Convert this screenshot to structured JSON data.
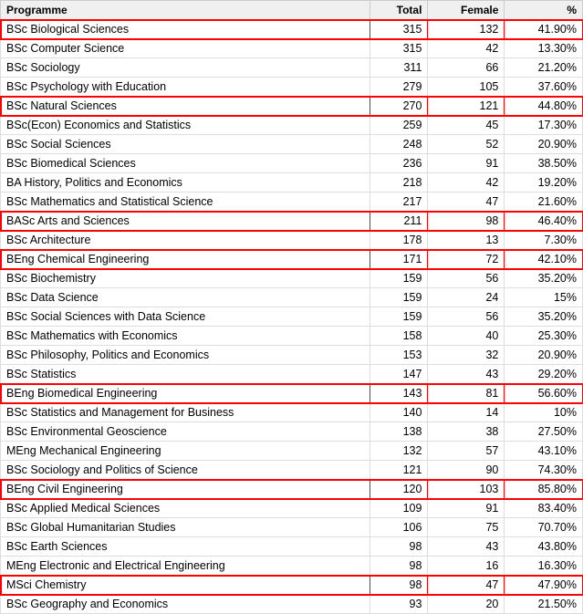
{
  "table": {
    "columns": [
      "Programme",
      "Total",
      "Female",
      "%"
    ],
    "rows": [
      {
        "name": "BSc Biological Sciences",
        "total": 315,
        "female": 132,
        "pct": "41.90%",
        "highlight": true
      },
      {
        "name": "BSc Computer Science",
        "total": 315,
        "female": 42,
        "pct": "13.30%",
        "highlight": false
      },
      {
        "name": "BSc Sociology",
        "total": 311,
        "female": 66,
        "pct": "21.20%",
        "highlight": false
      },
      {
        "name": "BSc Psychology with Education",
        "total": 279,
        "female": 105,
        "pct": "37.60%",
        "highlight": false
      },
      {
        "name": "BSc Natural Sciences",
        "total": 270,
        "female": 121,
        "pct": "44.80%",
        "highlight": true
      },
      {
        "name": "BSc(Econ) Economics and Statistics",
        "total": 259,
        "female": 45,
        "pct": "17.30%",
        "highlight": false
      },
      {
        "name": "BSc Social Sciences",
        "total": 248,
        "female": 52,
        "pct": "20.90%",
        "highlight": false
      },
      {
        "name": "BSc Biomedical Sciences",
        "total": 236,
        "female": 91,
        "pct": "38.50%",
        "highlight": false
      },
      {
        "name": "BA History, Politics and Economics",
        "total": 218,
        "female": 42,
        "pct": "19.20%",
        "highlight": false
      },
      {
        "name": "BSc Mathematics and Statistical Science",
        "total": 217,
        "female": 47,
        "pct": "21.60%",
        "highlight": false
      },
      {
        "name": "BASc Arts and Sciences",
        "total": 211,
        "female": 98,
        "pct": "46.40%",
        "highlight": true
      },
      {
        "name": "BSc Architecture",
        "total": 178,
        "female": 13,
        "pct": "7.30%",
        "highlight": false
      },
      {
        "name": "BEng Chemical Engineering",
        "total": 171,
        "female": 72,
        "pct": "42.10%",
        "highlight": true
      },
      {
        "name": "BSc Biochemistry",
        "total": 159,
        "female": 56,
        "pct": "35.20%",
        "highlight": false
      },
      {
        "name": "BSc Data Science",
        "total": 159,
        "female": 24,
        "pct": "15%",
        "highlight": false
      },
      {
        "name": "BSc Social Sciences with Data Science",
        "total": 159,
        "female": 56,
        "pct": "35.20%",
        "highlight": false
      },
      {
        "name": "BSc Mathematics with Economics",
        "total": 158,
        "female": 40,
        "pct": "25.30%",
        "highlight": false
      },
      {
        "name": "BSc Philosophy, Politics and Economics",
        "total": 153,
        "female": 32,
        "pct": "20.90%",
        "highlight": false
      },
      {
        "name": "BSc Statistics",
        "total": 147,
        "female": 43,
        "pct": "29.20%",
        "highlight": false
      },
      {
        "name": "BEng Biomedical Engineering",
        "total": 143,
        "female": 81,
        "pct": "56.60%",
        "highlight": true
      },
      {
        "name": "BSc Statistics and Management for Business",
        "total": 140,
        "female": 14,
        "pct": "10%",
        "highlight": false
      },
      {
        "name": "BSc Environmental Geoscience",
        "total": 138,
        "female": 38,
        "pct": "27.50%",
        "highlight": false
      },
      {
        "name": "MEng Mechanical Engineering",
        "total": 132,
        "female": 57,
        "pct": "43.10%",
        "highlight": false
      },
      {
        "name": "BSc Sociology and Politics of Science",
        "total": 121,
        "female": 90,
        "pct": "74.30%",
        "highlight": false
      },
      {
        "name": "BEng Civil Engineering",
        "total": 120,
        "female": 103,
        "pct": "85.80%",
        "highlight": true
      },
      {
        "name": "BSc Applied Medical Sciences",
        "total": 109,
        "female": 91,
        "pct": "83.40%",
        "highlight": false
      },
      {
        "name": "BSc Global Humanitarian Studies",
        "total": 106,
        "female": 75,
        "pct": "70.70%",
        "highlight": false
      },
      {
        "name": "BSc Earth Sciences",
        "total": 98,
        "female": 43,
        "pct": "43.80%",
        "highlight": false
      },
      {
        "name": "MEng Electronic and Electrical Engineering",
        "total": 98,
        "female": 16,
        "pct": "16.30%",
        "highlight": false
      },
      {
        "name": "MSci Chemistry",
        "total": 98,
        "female": 47,
        "pct": "47.90%",
        "highlight": true
      },
      {
        "name": "BSc Geography and Economics",
        "total": 93,
        "female": 20,
        "pct": "21.50%",
        "highlight": false
      }
    ]
  }
}
